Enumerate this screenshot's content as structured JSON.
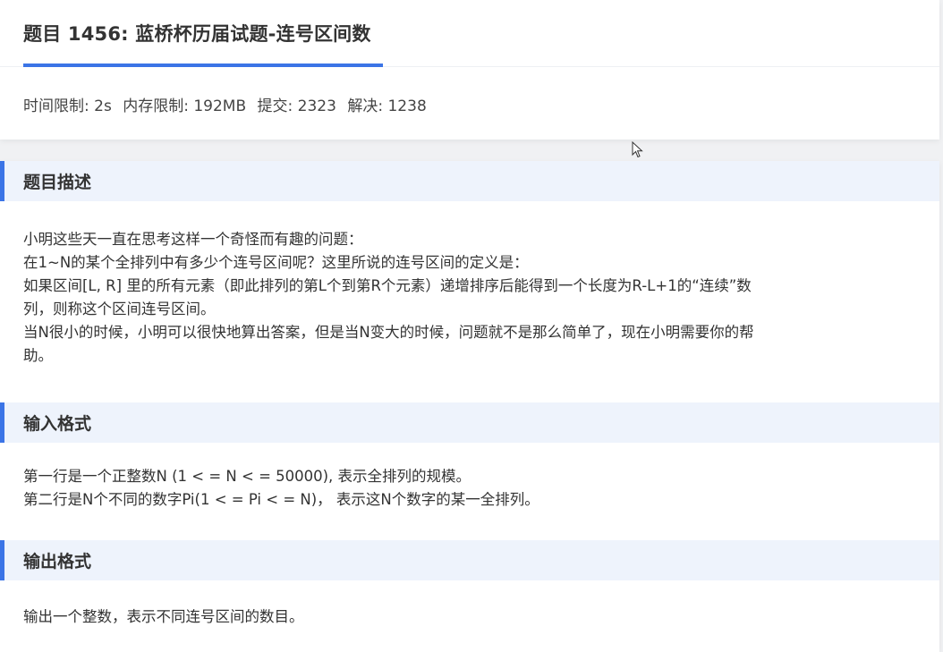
{
  "problem": {
    "title": "题目 1456: 蓝桥杯历届试题-连号区间数",
    "meta": {
      "time_limit": "时间限制: 2s",
      "memory_limit": "内存限制: 192MB",
      "submissions": "提交: 2323",
      "solved": "解决: 1238"
    }
  },
  "sections": {
    "description": {
      "title": "题目描述",
      "lines": [
        "小明这些天一直在思考这样一个奇怪而有趣的问题：",
        "在1~N的某个全排列中有多少个连号区间呢？这里所说的连号区间的定义是：",
        "如果区间[L, R] 里的所有元素（即此排列的第L个到第R个元素）递增排序后能得到一个长度为R-L+1的“连续”数",
        "列，则称这个区间连号区间。",
        "当N很小的时候，小明可以很快地算出答案，但是当N变大的时候，问题就不是那么简单了，现在小明需要你的帮",
        "助。"
      ]
    },
    "input": {
      "title": "输入格式",
      "lines": [
        "第一行是一个正整数N (1 < = N < = 50000), 表示全排列的规模。",
        "第二行是N个不同的数字Pi(1 < = Pi < = N)，  表示这N个数字的某一全排列。"
      ]
    },
    "output": {
      "title": "输出格式",
      "lines": [
        "输出一个整数，表示不同连号区间的数目。"
      ]
    }
  },
  "colors": {
    "accent": "#3b74e6",
    "section_bg": "#eef3fc",
    "page_bg": "#f0f1f3"
  },
  "icons": {
    "cursor": "mouse-pointer-icon"
  }
}
